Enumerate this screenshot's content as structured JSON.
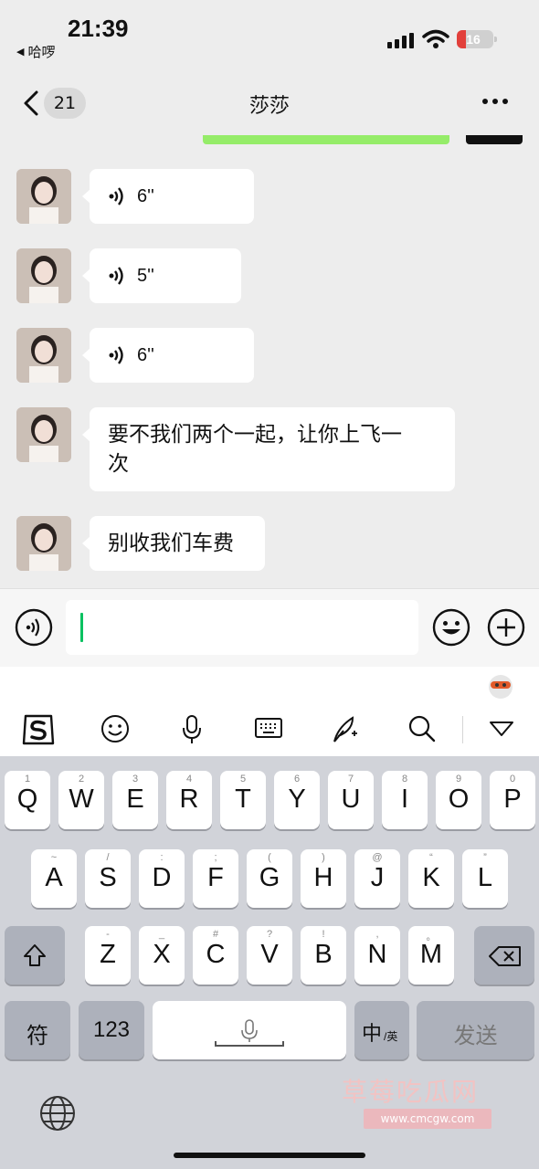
{
  "status": {
    "time": "21:39",
    "back_app": "哈啰",
    "battery": "16"
  },
  "nav": {
    "unread": "21",
    "title": "莎莎",
    "more_icon": "more-dots-icon",
    "back_icon": "chevron-left-icon"
  },
  "messages": [
    {
      "type": "voice",
      "duration": "6''"
    },
    {
      "type": "voice",
      "duration": "5''"
    },
    {
      "type": "voice",
      "duration": "6''"
    },
    {
      "type": "text",
      "line1": "要不我们两个一起，让你上飞一",
      "line2": "次"
    },
    {
      "type": "text",
      "line1": "别收我们车费"
    }
  ],
  "input": {
    "value": "",
    "voice_icon": "voice-mode-icon",
    "emoji_icon": "emoji-icon",
    "plus_icon": "plus-icon"
  },
  "keyboard": {
    "toolbar_icons": [
      "sogou-logo-icon",
      "smiley-icon",
      "microphone-icon",
      "keyboard-icon",
      "quill-icon",
      "search-icon",
      "collapse-icon"
    ],
    "row1": [
      {
        "m": "Q",
        "s": "1"
      },
      {
        "m": "W",
        "s": "2"
      },
      {
        "m": "E",
        "s": "3"
      },
      {
        "m": "R",
        "s": "4"
      },
      {
        "m": "T",
        "s": "5"
      },
      {
        "m": "Y",
        "s": "6"
      },
      {
        "m": "U",
        "s": "7"
      },
      {
        "m": "I",
        "s": "8"
      },
      {
        "m": "O",
        "s": "9"
      },
      {
        "m": "P",
        "s": "0"
      }
    ],
    "row2": [
      {
        "m": "A",
        "s": "~"
      },
      {
        "m": "S",
        "s": "/"
      },
      {
        "m": "D",
        "s": ":"
      },
      {
        "m": "F",
        "s": ";"
      },
      {
        "m": "G",
        "s": "("
      },
      {
        "m": "H",
        "s": ")"
      },
      {
        "m": "J",
        "s": "@"
      },
      {
        "m": "K",
        "s": "“"
      },
      {
        "m": "L",
        "s": "”"
      }
    ],
    "row3": [
      {
        "m": "Z",
        "s": "-"
      },
      {
        "m": "X",
        "s": "_"
      },
      {
        "m": "C",
        "s": "#"
      },
      {
        "m": "V",
        "s": "?"
      },
      {
        "m": "B",
        "s": "!"
      },
      {
        "m": "N",
        "s": ","
      },
      {
        "m": "M",
        "s": "。"
      }
    ],
    "symbols": "符",
    "numbers": "123",
    "lang_main": "中",
    "lang_sub": "/英",
    "send": "发送"
  },
  "watermark": {
    "title": "草莓吃瓜网",
    "url": "www.cmcgw.com"
  }
}
